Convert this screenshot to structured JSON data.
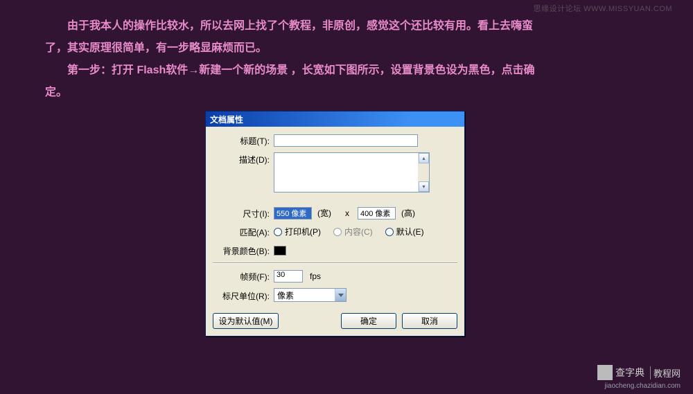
{
  "watermark": {
    "top": "思缘设计论坛 WWW.MISSYUAN.COM",
    "logo_small": "查字典",
    "logo_label": "教程网",
    "url": "jiaocheng.chazidian.com"
  },
  "body": {
    "p1a": "由于我本人的操作比较水，所以去网上找了个教程，非原创，感觉这个还比较有用。看上去嗨蛮",
    "p1b": "了，其实原理很简单，有一步略显麻烦而已。",
    "p2a": "第一步：打开 Flash软件→新建一个新的场景 ，长宽如下图所示，设置背景色设为黑色，点击确",
    "p2b": "定。"
  },
  "dialog": {
    "title": "文档属性",
    "labels": {
      "title": "标题(T):",
      "description": "描述(D):",
      "dimensions": "尺寸(I):",
      "match": "匹配(A):",
      "bgcolor": "背景颜色(B):",
      "framerate": "帧频(F):",
      "ruler": "标尺单位(R):"
    },
    "dimensions": {
      "width_value": "550 像素",
      "width_unit": "(宽)",
      "x": "x",
      "height_value": "400 像素",
      "height_unit": "(高)"
    },
    "match": {
      "printer": "打印机(P)",
      "content": "内容(C)",
      "default": "默认(E)"
    },
    "framerate": {
      "value": "30",
      "unit": "fps"
    },
    "ruler": {
      "value": "像素"
    },
    "buttons": {
      "default": "设为默认值(M)",
      "ok": "确定",
      "cancel": "取消"
    }
  }
}
